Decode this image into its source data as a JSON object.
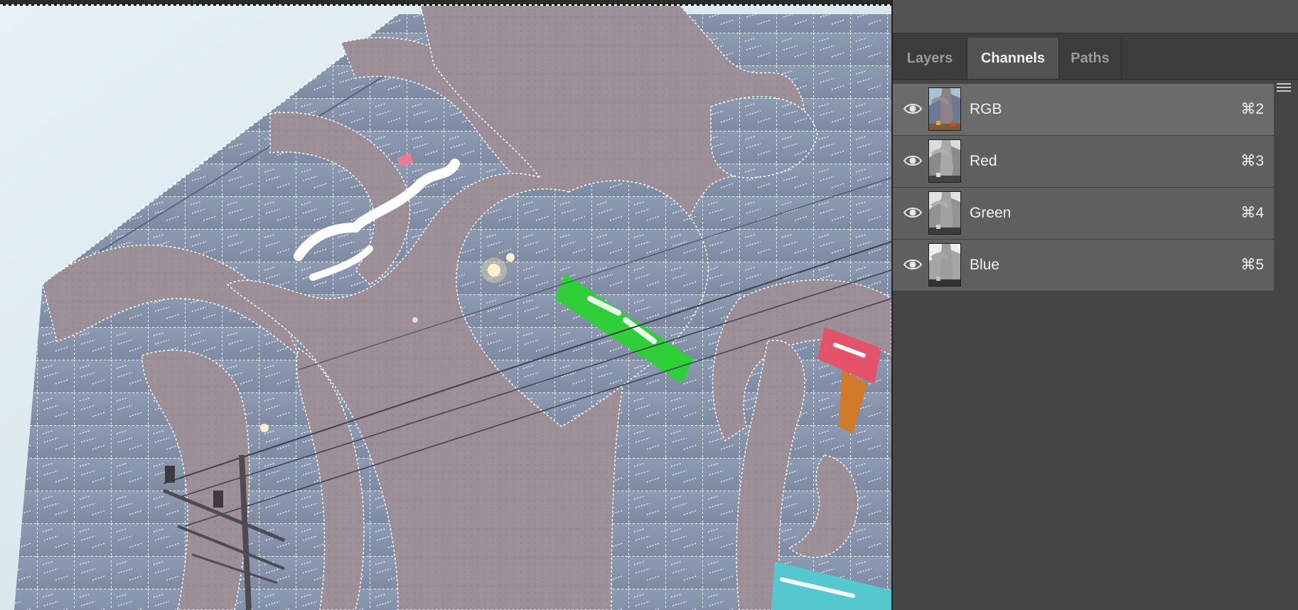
{
  "panel": {
    "tabs": [
      {
        "label": "Layers",
        "active": false
      },
      {
        "label": "Channels",
        "active": true
      },
      {
        "label": "Paths",
        "active": false
      }
    ],
    "menu_icon": "panel-menu-icon",
    "channels": [
      {
        "name": "RGB",
        "shortcut": "⌘2",
        "visible": true,
        "thumbnail": "color"
      },
      {
        "name": "Red",
        "shortcut": "⌘3",
        "visible": true,
        "thumbnail": "grayscale"
      },
      {
        "name": "Green",
        "shortcut": "⌘4",
        "visible": true,
        "thumbnail": "grayscale"
      },
      {
        "name": "Blue",
        "shortcut": "⌘5",
        "visible": true,
        "thumbnail": "grayscale"
      }
    ]
  },
  "canvas": {
    "image": "building-photo-with-active-selection",
    "selection": "marching-ants"
  },
  "colors": {
    "panel_bg": "#454545",
    "row_bg": "#5f5f5f",
    "active_tab_bg": "#535353",
    "text": "#f0f0f0"
  }
}
